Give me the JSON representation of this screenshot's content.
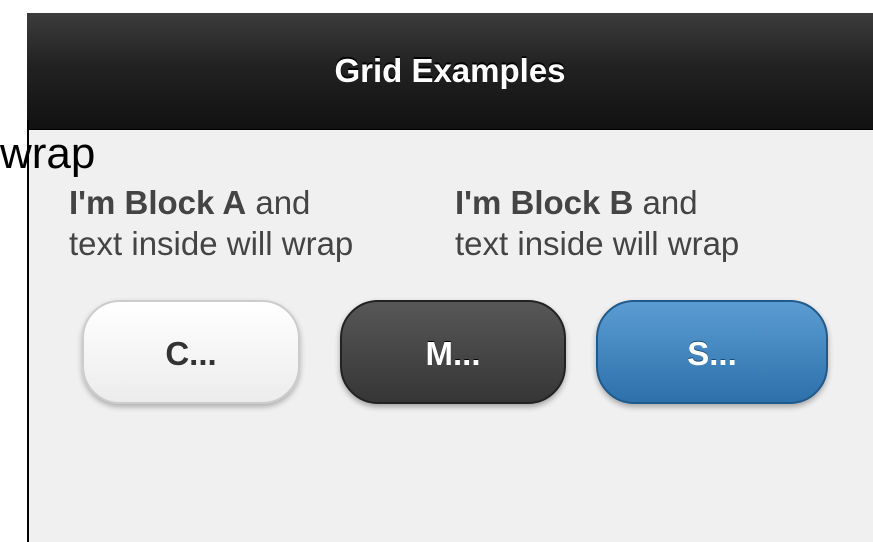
{
  "header": {
    "title": "Grid Examples"
  },
  "overflow_text": "wrap",
  "grid": {
    "block_a": {
      "bold": "I'm Block A",
      "rest_line1": " and",
      "line2": "text inside will wrap"
    },
    "block_b": {
      "bold": "I'm Block B",
      "rest_line1": " and",
      "line2": "text inside will wrap"
    }
  },
  "buttons": [
    {
      "label": "C...",
      "theme": "light"
    },
    {
      "label": "M...",
      "theme": "dark"
    },
    {
      "label": "S...",
      "theme": "blue"
    }
  ],
  "colors": {
    "header_bg": "#1e1e1e",
    "content_bg": "#f0f0f0",
    "button_blue": "#3a80bd",
    "button_dark": "#444444",
    "button_light": "#f6f6f6"
  }
}
